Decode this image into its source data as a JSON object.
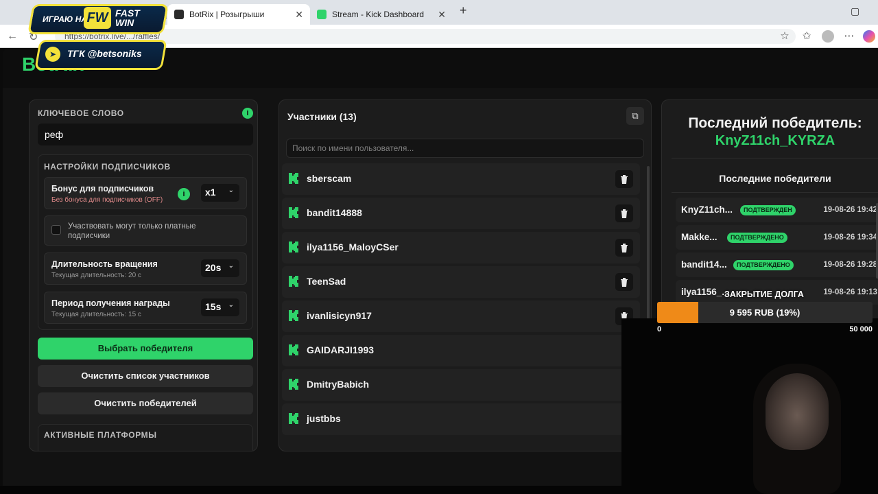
{
  "browser": {
    "tabs": [
      {
        "title": "BotRix | Розыгрыши",
        "favicon_color": "#2b2b2b"
      },
      {
        "title": "Stream - Kick Dashboard",
        "favicon_color": "#2fd36a"
      }
    ],
    "url": "https://botrix.live/.../raffles/"
  },
  "promo": {
    "line1": "ИГРАЮ НА",
    "logo": "FW",
    "brand": "FAST WIN",
    "line2": "ТГК @betsoniks"
  },
  "app": {
    "brand": "BotRix"
  },
  "left": {
    "keyword_label": "КЛЮЧЕВОЕ СЛОВО",
    "keyword_value": "реф",
    "sub_settings_label": "НАСТРОЙКИ ПОДПИСЧИКОВ",
    "bonus_title": "Бонус для подписчиков",
    "bonus_sub": "Без бонуса для подписчиков (OFF)",
    "bonus_value": "x1",
    "paid_only": "Участвовать могут только платные подписчики",
    "spin_title": "Длительность вращения",
    "spin_sub": "Текущая длительность: 20 с",
    "spin_value": "20s",
    "claim_title": "Период получения награды",
    "claim_sub": "Текущая длительность: 15 с",
    "claim_value": "15s",
    "pick_winner": "Выбрать победителя",
    "clear_participants": "Очистить список участников",
    "clear_winners": "Очистить победителей",
    "platforms_label": "АКТИВНЫЕ ПЛАТФОРМЫ"
  },
  "participants": {
    "title": "Участники (13)",
    "search_placeholder": "Поиск по имени пользователя...",
    "items": [
      {
        "name": "sberscam"
      },
      {
        "name": "bandit14888"
      },
      {
        "name": "ilya1156_MaloyCSer"
      },
      {
        "name": "TeenSad"
      },
      {
        "name": "ivanlisicyn917"
      },
      {
        "name": "GAIDARJI1993"
      },
      {
        "name": "DmitryBabich"
      },
      {
        "name": "justbbs"
      }
    ]
  },
  "winners": {
    "last_label": "Последний победитель:",
    "last_name": "KnyZ11ch_KYRZA",
    "recent_label": "Последние победители",
    "rows": [
      {
        "name": "KnyZ11ch...",
        "status": "ПОДТВЕРЖДЕН",
        "date": "19-08-26 19:42"
      },
      {
        "name": "Makke...",
        "status": "ПОДТВЕРЖДЕНО",
        "date": "19-08-26 19:34"
      },
      {
        "name": "bandit14...",
        "status": "ПОДТВЕРЖДЕНО",
        "date": "19-08-26 19:28"
      },
      {
        "name": "ilya1156_...",
        "status": "",
        "date": "19-08-26 19:13"
      }
    ]
  },
  "debt": {
    "label": "ЗАКРЫТИЕ ДОЛГА",
    "text": "9 595 RUB (19%)",
    "percent": 19,
    "min": "0",
    "max": "50 000"
  },
  "colors": {
    "accent": "#2fd36a",
    "debt_fill": "#ef8a18"
  }
}
